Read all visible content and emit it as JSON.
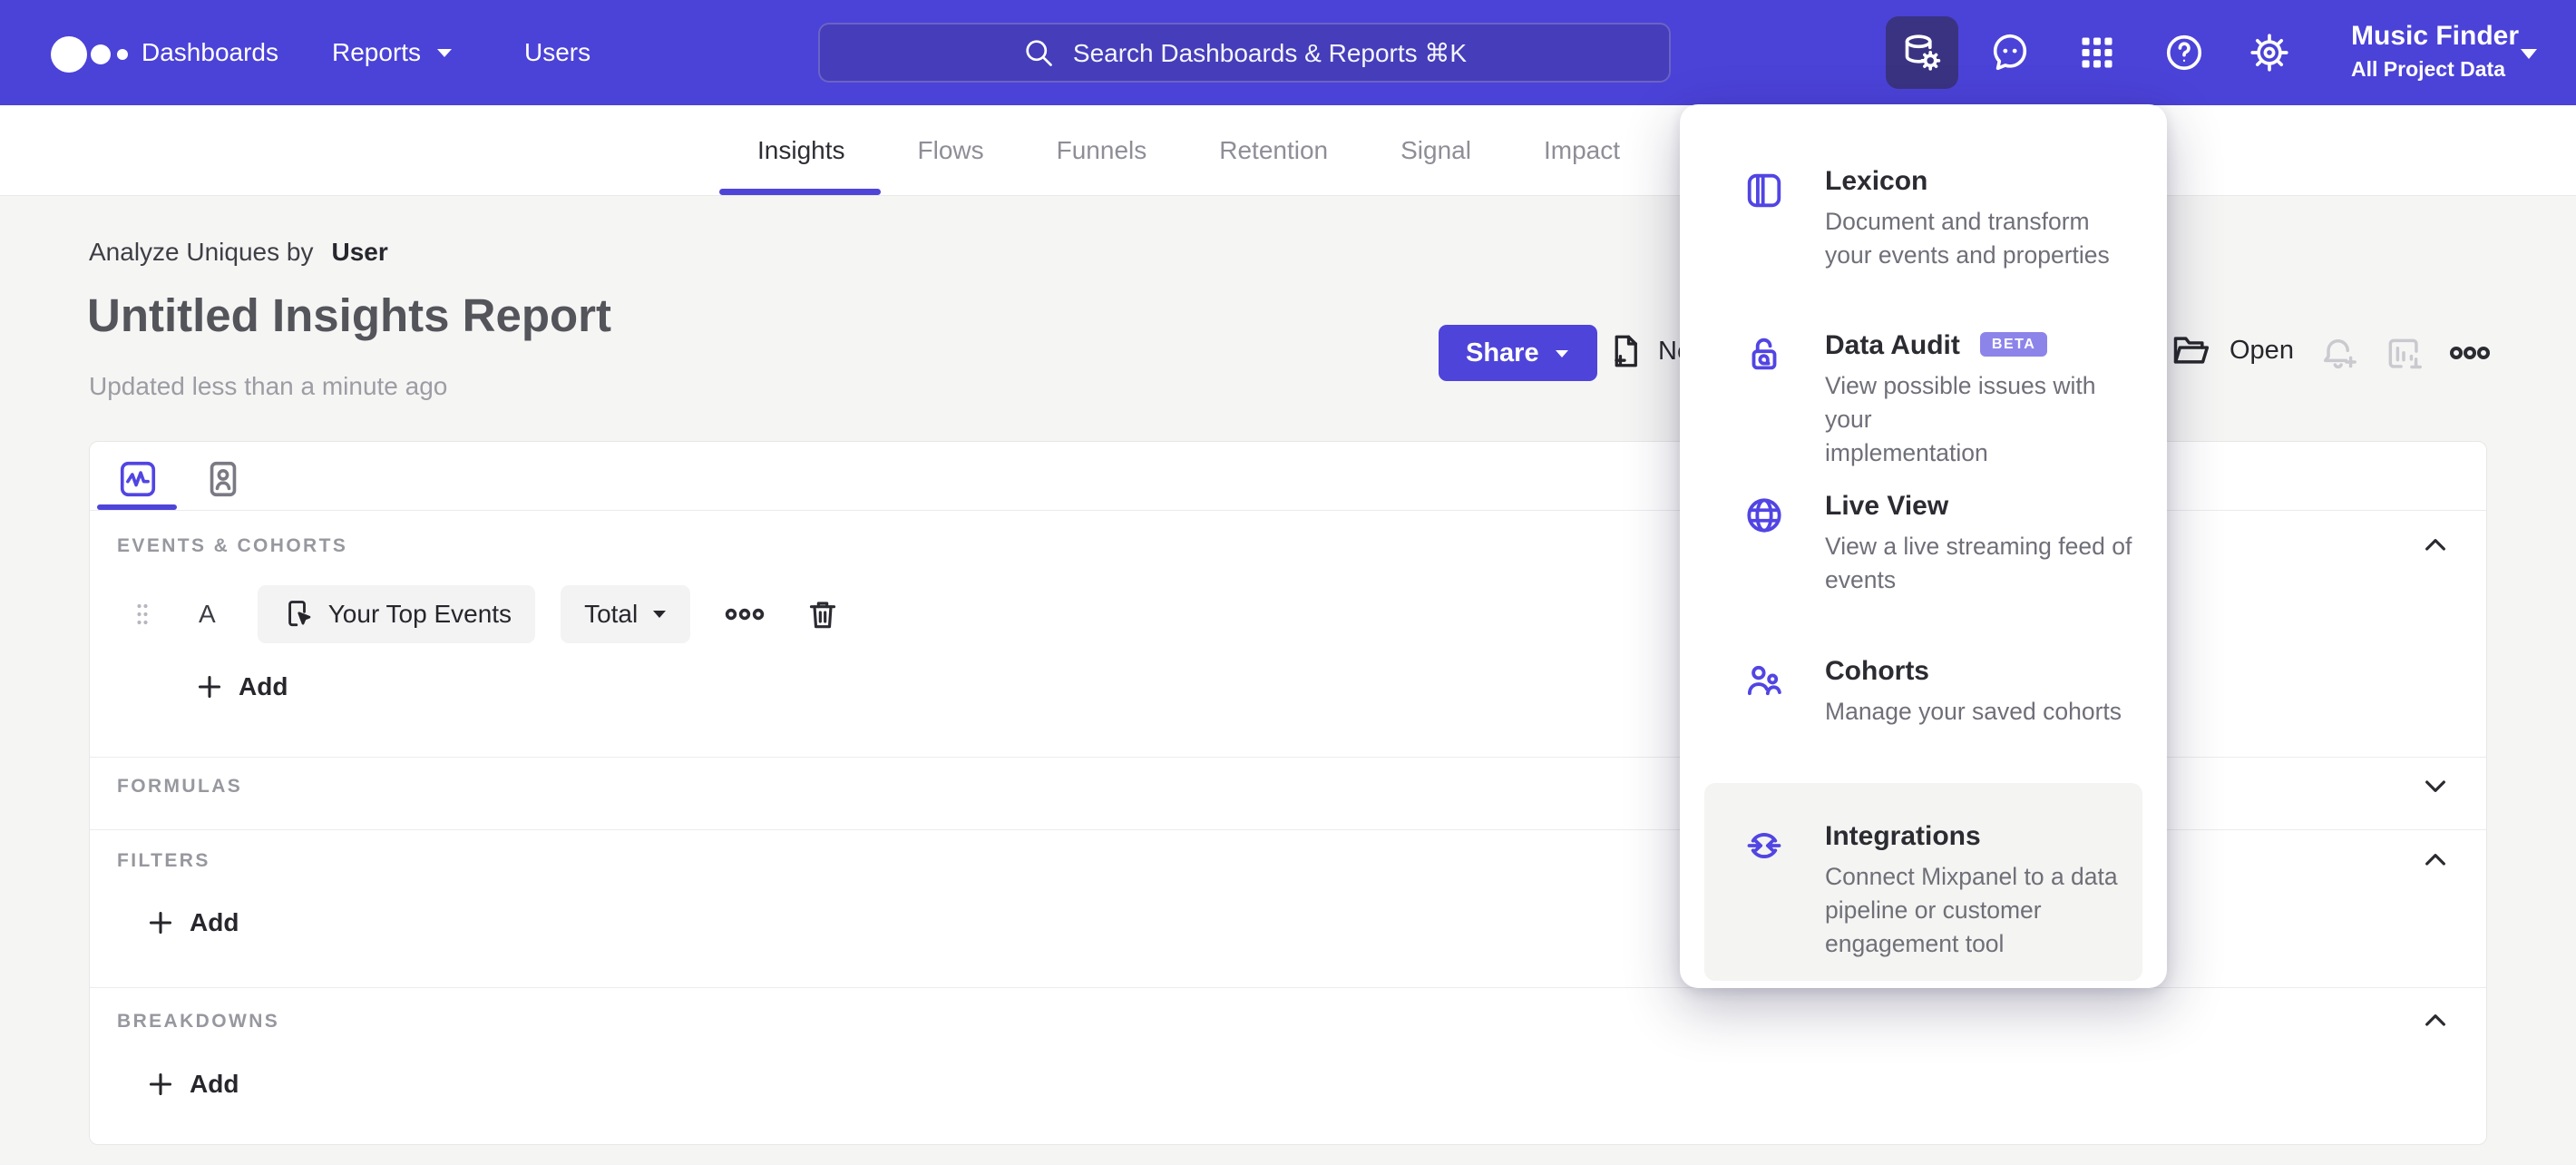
{
  "topnav": {
    "links": [
      {
        "label": "Dashboards"
      },
      {
        "label": "Reports",
        "has_caret": true
      },
      {
        "label": "Users"
      }
    ],
    "search": {
      "placeholder": "Search Dashboards & Reports ⌘K"
    },
    "project": {
      "name": "Music Finder",
      "scope": "All Project Data"
    }
  },
  "tabs": [
    "Insights",
    "Flows",
    "Funnels",
    "Retention",
    "Signal",
    "Impact"
  ],
  "header": {
    "analyze_prefix": "Analyze Uniques by",
    "analyze_entity": "User",
    "title": "Untitled Insights Report",
    "updated": "Updated less than a minute ago",
    "share_label": "Share",
    "new_label": "New",
    "open_label": "Open"
  },
  "builder": {
    "sections": {
      "events": "EVENTS & COHORTS",
      "formulas": "FORMULAS",
      "filters": "FILTERS",
      "breakdowns": "BREAKDOWNS"
    },
    "event_row": {
      "letter": "A",
      "event": "Your Top Events",
      "metric": "Total"
    },
    "add_label": "Add"
  },
  "menu": {
    "items": [
      {
        "title": "Lexicon",
        "desc": "Document and transform\nyour events and properties"
      },
      {
        "title": "Data Audit",
        "badge": "BETA",
        "desc": "View possible issues with your\nimplementation"
      },
      {
        "title": "Live View",
        "desc": "View a live streaming feed of\nevents"
      },
      {
        "title": "Cohorts",
        "desc": "Manage your saved cohorts"
      },
      {
        "title": "Integrations",
        "desc": "Connect Mixpanel to a data\npipeline or customer\nengagement tool",
        "highlighted": true
      }
    ]
  },
  "colors": {
    "nav_purple": "#4b42d8",
    "accent_purple": "#4f44d9",
    "icon_purple": "#5145e3",
    "beta_badge": "#8d84ea",
    "active_nav_btn": "#3a3382",
    "page_bg": "#f5f5f4"
  }
}
